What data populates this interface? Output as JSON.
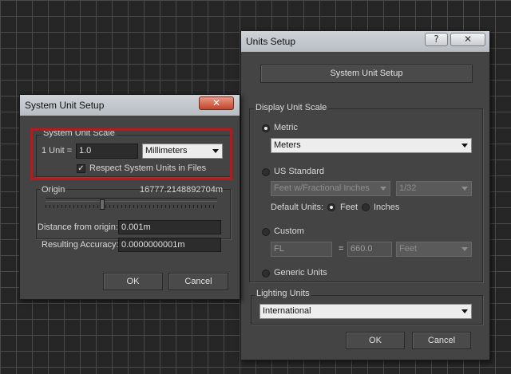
{
  "units_setup": {
    "title": "Units Setup",
    "help_button": "?",
    "close_button": "✕",
    "system_unit_setup_button": "System Unit Setup",
    "display_unit_scale": {
      "label": "Display Unit Scale",
      "metric": {
        "label": "Metric",
        "selected": true,
        "value": "Meters"
      },
      "us_standard": {
        "label": "US Standard",
        "selected": false,
        "value": "Feet w/Fractional Inches",
        "fraction": "1/32",
        "default_units_label": "Default Units:",
        "feet_label": "Feet",
        "inches_label": "Inches",
        "feet_selected": true
      },
      "custom": {
        "label": "Custom",
        "selected": false,
        "name": "FL",
        "equals": "=",
        "value": "660.0",
        "unit": "Feet"
      },
      "generic_units": {
        "label": "Generic Units",
        "selected": false
      }
    },
    "lighting_units": {
      "label": "Lighting Units",
      "value": "International"
    },
    "ok": "OK",
    "cancel": "Cancel"
  },
  "system_unit_setup": {
    "title": "System Unit Setup",
    "close_button": "✕",
    "scale": {
      "label": "System Unit Scale",
      "unit_label": "1 Unit =",
      "unit_value": "1.0",
      "unit_type": "Millimeters",
      "respect_label": "Respect System Units in Files",
      "respect_checked": true
    },
    "origin": {
      "label": "Origin",
      "value": "16777.2148892704m",
      "slider_fraction": 0.33
    },
    "distance_label": "Distance from origin:",
    "distance_value": "0.001m",
    "accuracy_label": "Resulting Accuracy:",
    "accuracy_value": "0.0000000001m",
    "ok": "OK",
    "cancel": "Cancel"
  },
  "colors": {
    "highlight": "#c0161a",
    "panel": "#444444"
  }
}
